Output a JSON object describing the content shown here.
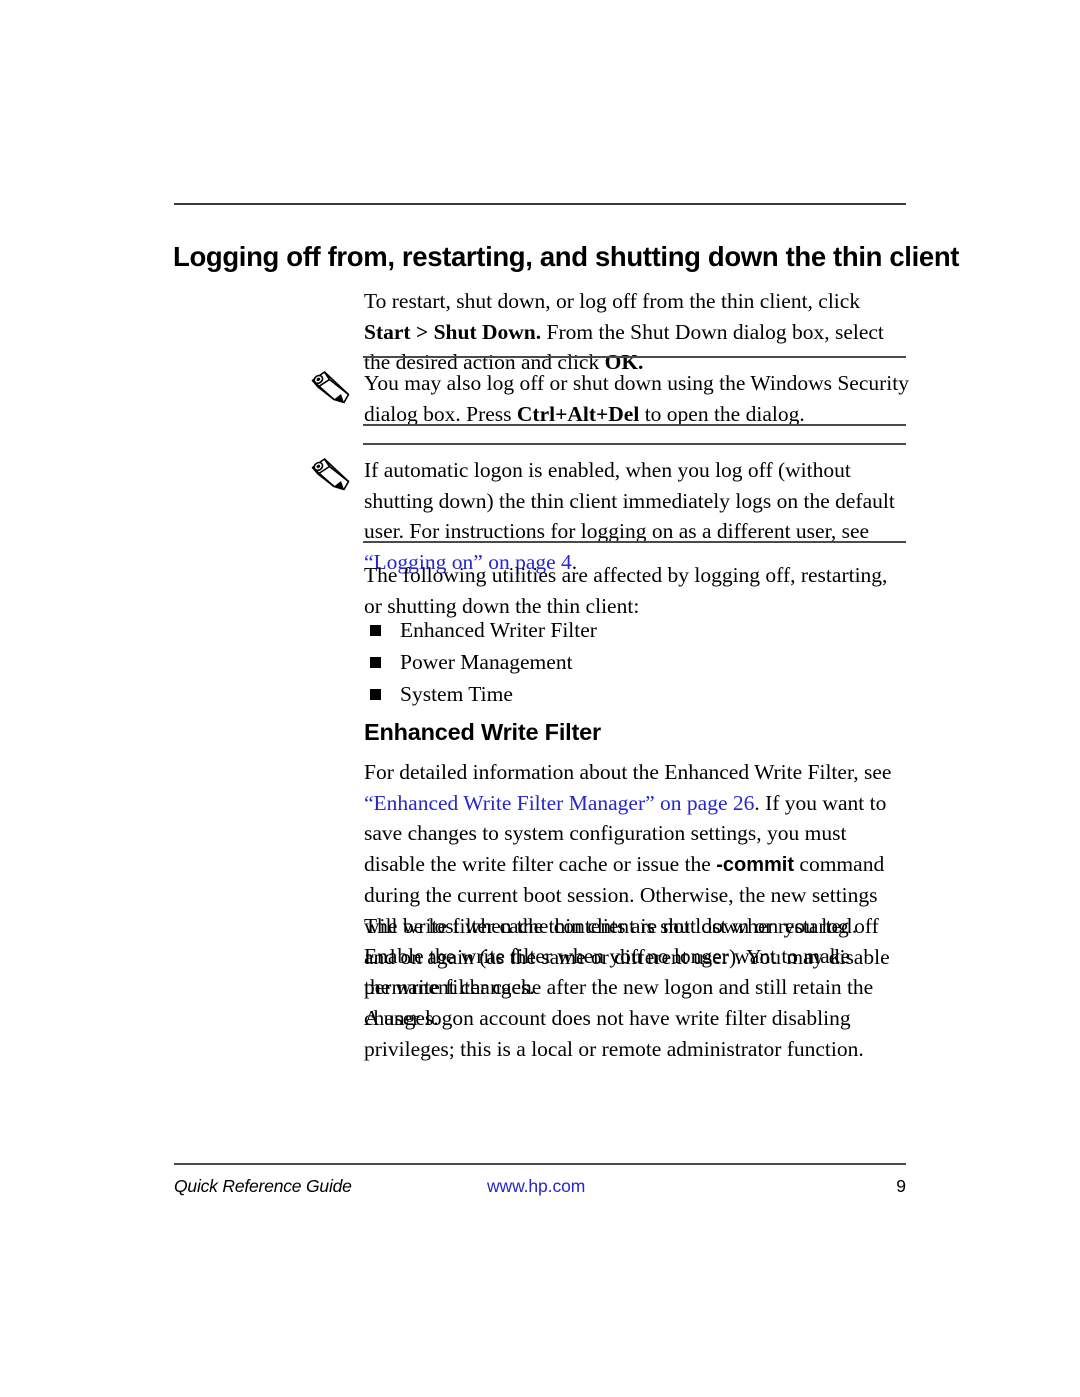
{
  "document": {
    "heading": "Logging off from, restarting, and shutting down the thin client",
    "intro": {
      "seg1": "To restart, shut down, or log off from the thin client, click ",
      "bold1": "Start > Shut Down.",
      "seg2": " From the Shut Down dialog box, select the desired action and click ",
      "bold2": "OK.",
      "seg3": ""
    },
    "notes": [
      {
        "icon": "pencil-note-icon",
        "seg1": "You may also log off or shut down using the Windows Security dialog box. Press ",
        "bold1": "Ctrl+Alt+Del",
        "seg2": " to open the dialog.",
        "link1": "",
        "seg3": ""
      },
      {
        "icon": "pencil-note-icon",
        "seg1": "If automatic logon is enabled, when you log off (without shutting down) the thin client immediately logs on the default user. For instructions for logging on as a different user, see ",
        "bold1": "",
        "link1": "“Logging on” on page 4",
        "seg2": "",
        "seg3": "."
      }
    ],
    "utilities_intro": "The following utilities are affected by logging off, restarting, or shutting down the thin client:",
    "utilities": [
      "Enhanced Writer Filter",
      "Power Management",
      "System Time"
    ],
    "section": {
      "heading": "Enhanced Write Filter",
      "paragraph1": {
        "seg1": "For detailed information about the Enhanced Write Filter, see ",
        "link1": "“Enhanced Write Filter Manager” on page 26",
        "seg2": ". If you want to save changes to system configuration settings, you must disable the write filter cache or issue the ",
        "bold1": "-commit",
        "seg3": " command during the current boot session. Otherwise, the new settings will be lost when the thin client is shut down or restarted. Enable the write filter when you no longer want to make permanent changes."
      },
      "paragraph2": "The write filter cache contents are not lost when you log off and on again (as the same or different user). You may disable the write filter cache after the new logon and still retain the changes.",
      "paragraph3": "A user logon account does not have write filter disabling privileges; this is a local or remote administrator function."
    },
    "footer": {
      "left": "Quick Reference Guide",
      "center": "www.hp.com",
      "page_number": "9"
    },
    "colors": {
      "link": "#2626cc",
      "text": "#000000",
      "rule": "#3a3a3a",
      "background": "#ffffff"
    }
  }
}
